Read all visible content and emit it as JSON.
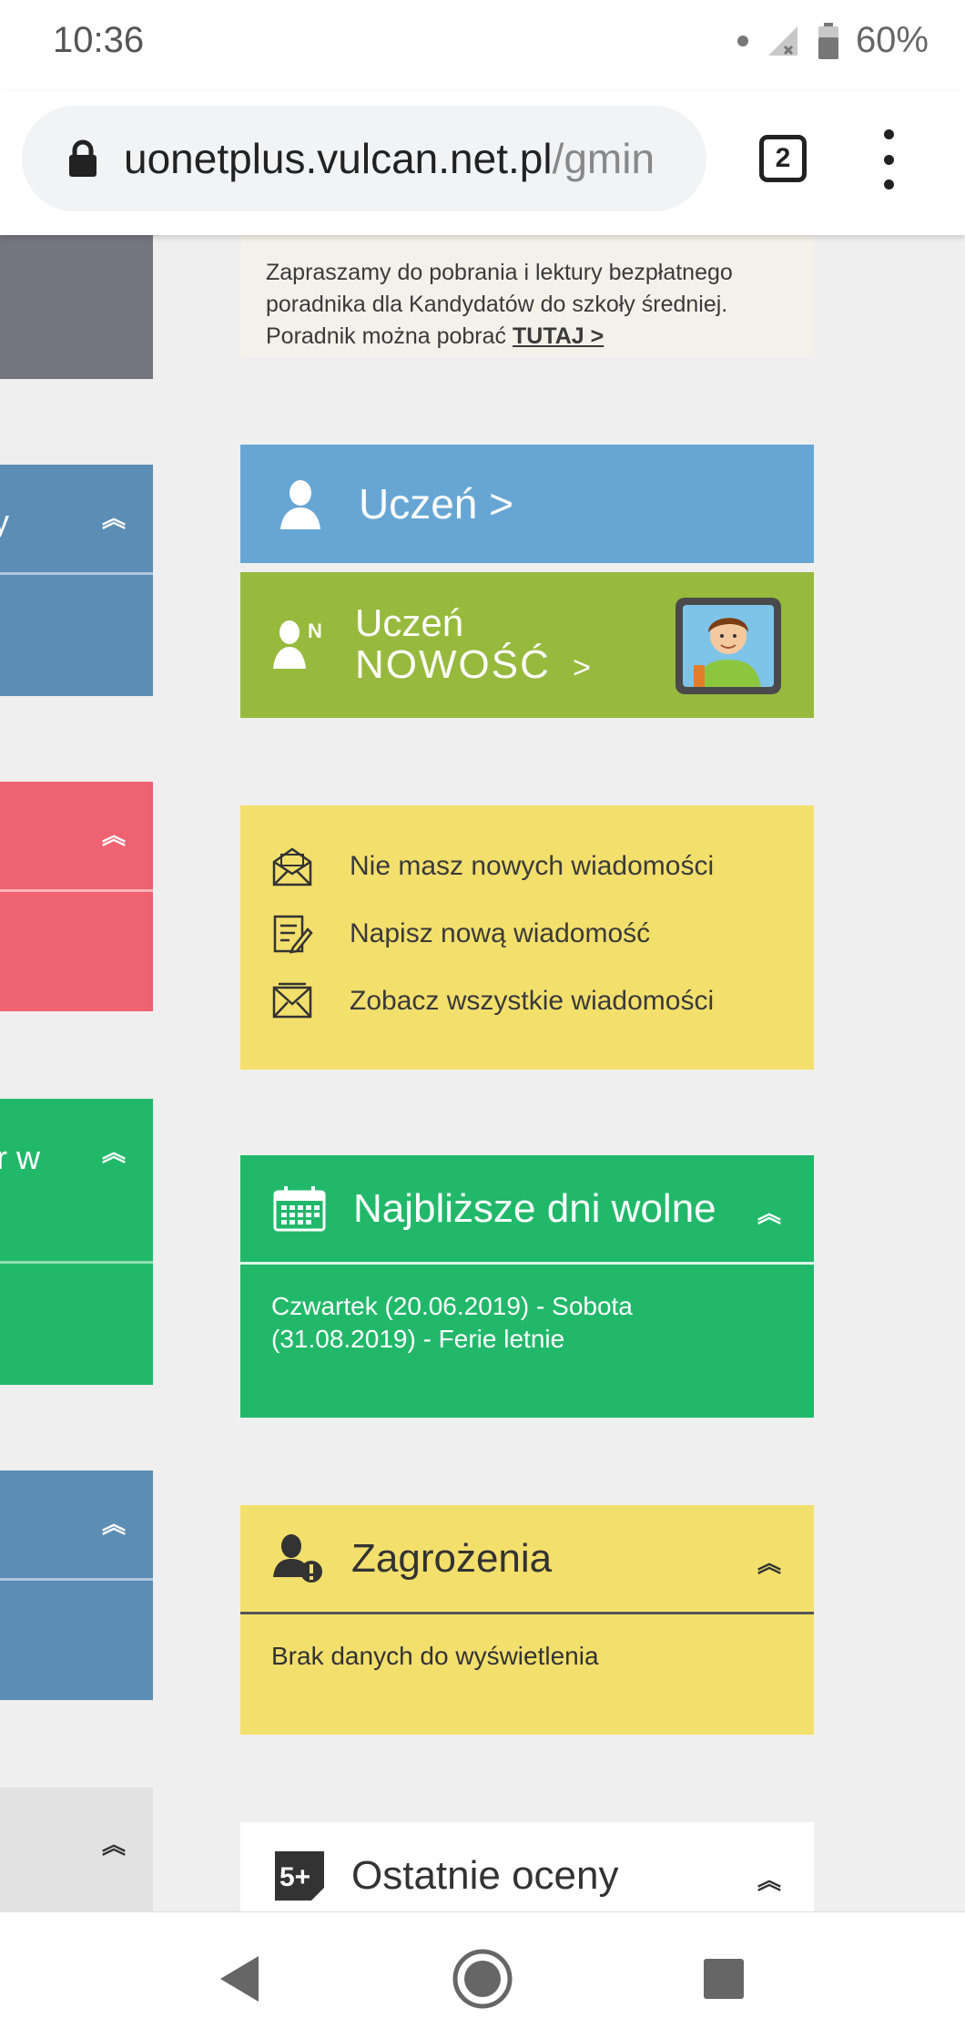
{
  "status": {
    "time": "10:36",
    "battery": "60%"
  },
  "browser": {
    "url_host": "uonetplus.vulcan.net.pl",
    "url_path": "/gmin",
    "tab_count": "2"
  },
  "left_column": {
    "partial_text_1": "y",
    "partial_text_2": "r w"
  },
  "promo": {
    "text": "Zapraszamy do pobrania i lektury bezpłatnego poradnika dla Kandydatów do szkoły średniej. Poradnik można pobrać",
    "link": "TUTAJ >"
  },
  "tiles": {
    "uczen": "Uczeń >",
    "uczen_new_line1": "Uczeń",
    "uczen_new_line2": "NOWOŚĆ",
    "uczen_new_arrow": ">"
  },
  "messages": {
    "items": [
      "Nie masz nowych wiadomości",
      "Napisz nową wiadomość",
      "Zobacz wszystkie wiadomości"
    ]
  },
  "free_days": {
    "title": "Najbliższe dni wolne",
    "text": "Czwartek (20.06.2019) - Sobota (31.08.2019) - Ferie letnie"
  },
  "threats": {
    "title": "Zagrożenia",
    "text": "Brak danych do wyświetlenia"
  },
  "grades": {
    "title": "Ostatnie oceny",
    "icon_text": "5+"
  },
  "colors": {
    "blue": "#67a6d4",
    "olive": "#97b93e",
    "yellow": "#f3df6c",
    "green": "#22b86a",
    "red": "#ef6272",
    "steel": "#5b8db5"
  }
}
